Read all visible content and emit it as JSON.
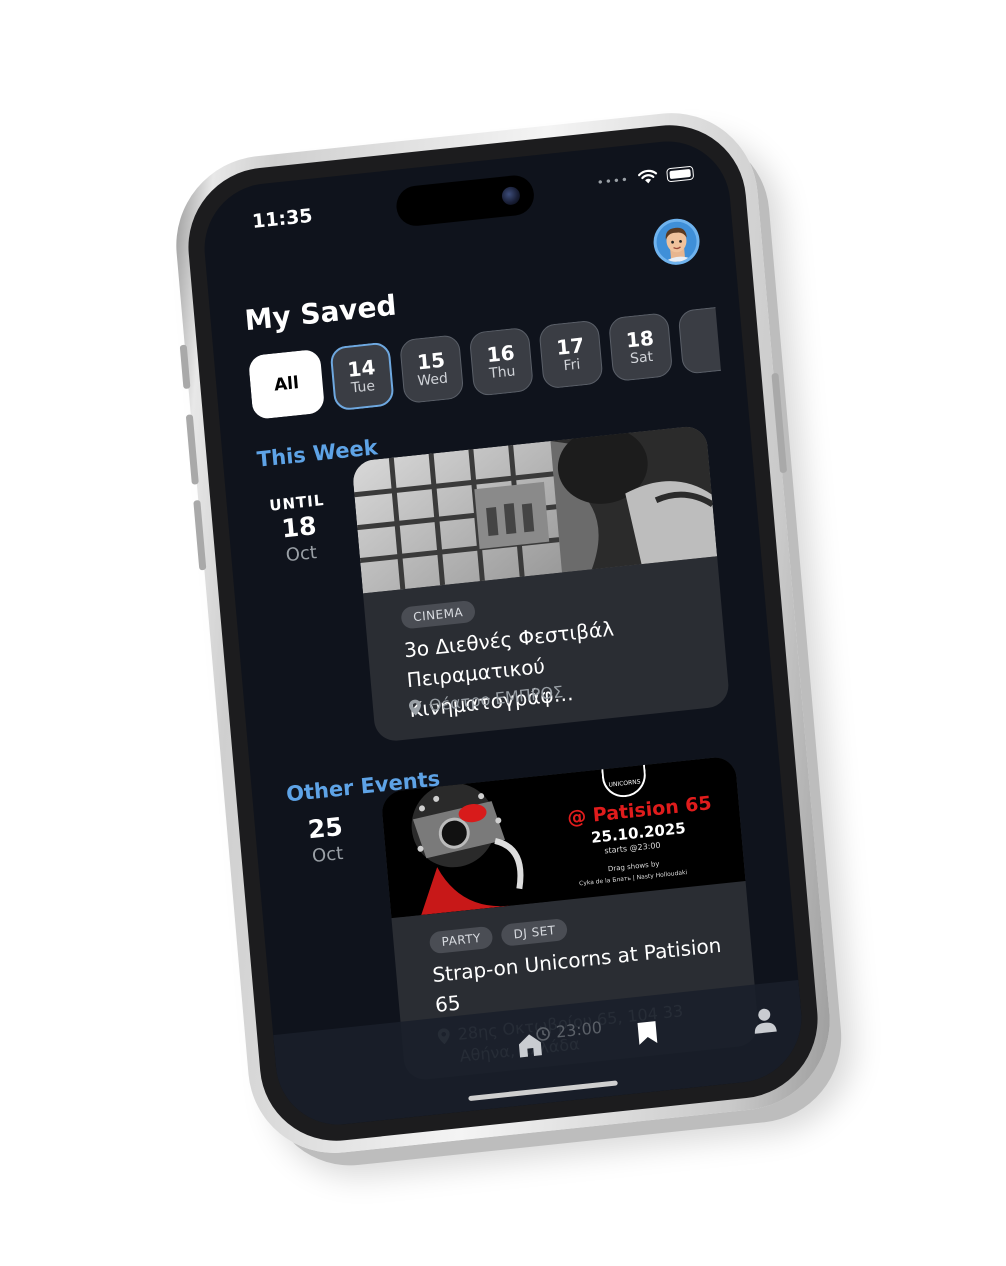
{
  "status_bar": {
    "time": "11:35",
    "dots": "••••"
  },
  "header": {
    "title": "My Saved",
    "avatar_icon": "memoji-avatar-icon"
  },
  "date_filter": {
    "all_label": "All",
    "days": [
      {
        "num": "14",
        "day": "Tue",
        "selected": true
      },
      {
        "num": "15",
        "day": "Wed"
      },
      {
        "num": "16",
        "day": "Thu"
      },
      {
        "num": "17",
        "day": "Fri"
      },
      {
        "num": "18",
        "day": "Sat"
      }
    ]
  },
  "this_week": {
    "label": "This Week",
    "date": {
      "until": "UNTIL",
      "num": "18",
      "month": "Oct"
    },
    "event": {
      "tags": [
        "CINEMA"
      ],
      "title": "3ο Διεθνές Φεστιβάλ Πειραματικού Κινηματογράφ…",
      "location": "Θέατρο ΕΜΠΡΟΣ"
    }
  },
  "other_events": {
    "label": "Other Events",
    "date": {
      "num": "25",
      "month": "Oct"
    },
    "event": {
      "poster": {
        "venue": "@ Patision 65",
        "date": "25.10.2025",
        "starts": "starts @23:00",
        "drag": "Drag shows by",
        "performers": "Cyka de la Блать  |  Nasty Holloudaki",
        "logo_text": "UNICORNS"
      },
      "tags": [
        "PARTY",
        "DJ SET"
      ],
      "title": "Strap-on Unicorns at Patision 65",
      "location": "28ης Οκτωβρίου 65, 104 33 Αθήνα, Ελλάδα",
      "time": "23:00"
    }
  },
  "tabbar": {
    "items": [
      "home-icon",
      "bookmark-icon",
      "profile-icon"
    ],
    "active": "bookmark-icon"
  },
  "colors": {
    "background": "#0f131c",
    "accent": "#5ea3e6",
    "card": "#2a2d33"
  }
}
